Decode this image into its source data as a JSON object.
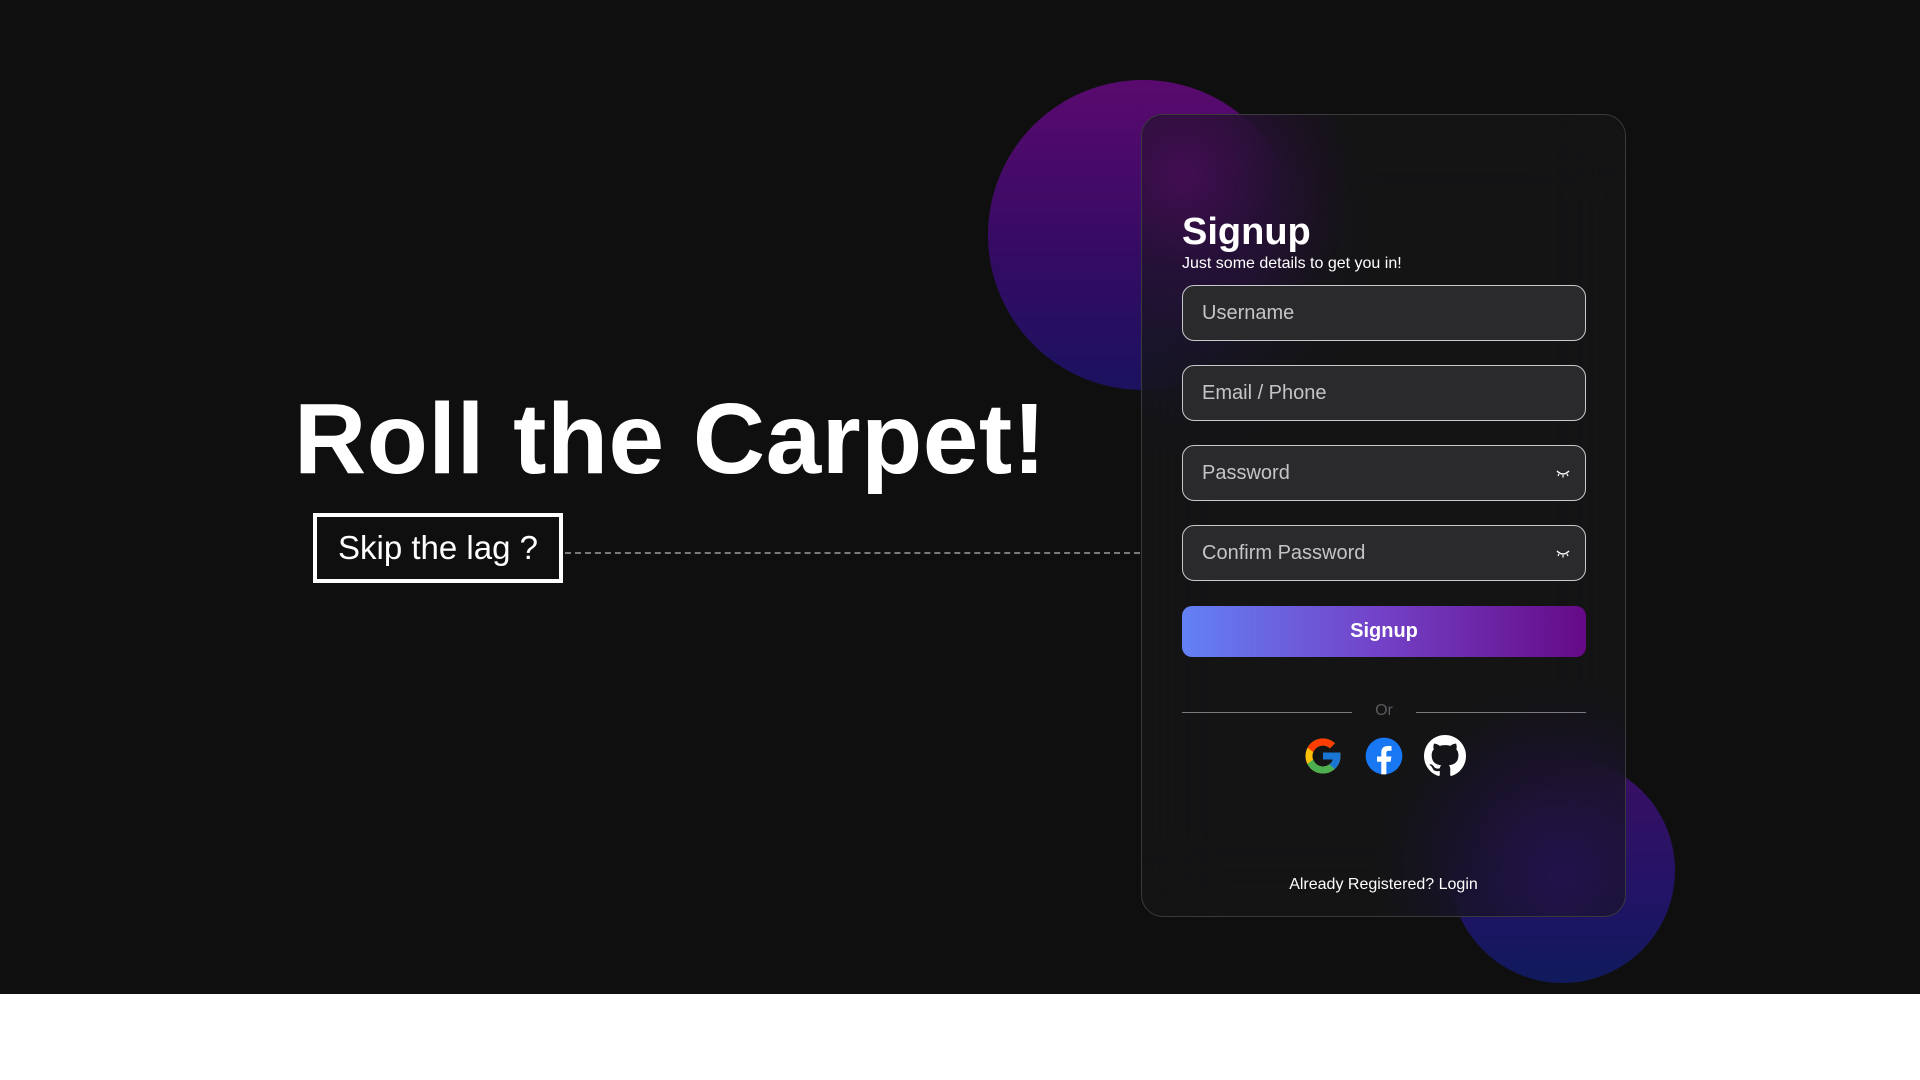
{
  "hero": {
    "title": "Roll the Carpet!",
    "skip_label": "Skip the lag ?"
  },
  "form": {
    "title": "Signup",
    "subtitle": "Just some details to get you in!",
    "username_placeholder": "Username",
    "email_placeholder": "Email / Phone",
    "password_placeholder": "Password",
    "confirm_password_placeholder": "Confirm Password",
    "submit_label": "Signup",
    "divider_label": "Or",
    "socials": [
      "google-icon",
      "facebook-icon",
      "github-icon"
    ],
    "login_prompt": "Already Registered?",
    "login_link": "Login"
  },
  "colors": {
    "background": "#0f0f10",
    "button_gradient_start": "#6381f5",
    "button_gradient_end": "#650a86",
    "facebook_blue": "#1877f2"
  }
}
